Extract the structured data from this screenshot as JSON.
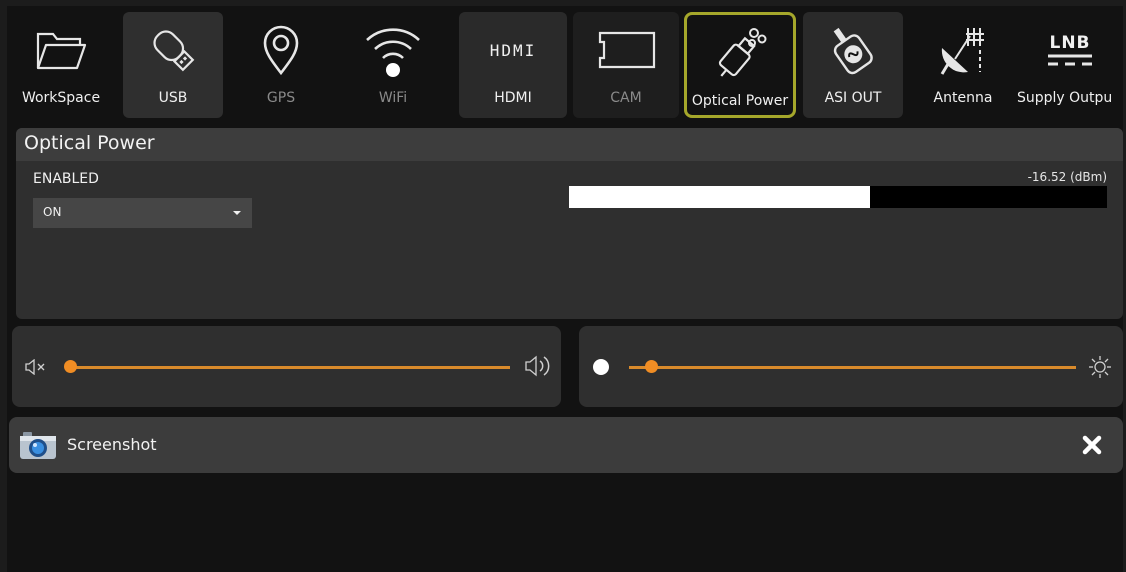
{
  "toolbar": {
    "items": [
      {
        "label": "WorkSpace",
        "icon": "folder-icon",
        "state": "normal"
      },
      {
        "label": "USB",
        "icon": "usb-drive-icon",
        "state": "normal"
      },
      {
        "label": "GPS",
        "icon": "map-pin-icon",
        "state": "disabled"
      },
      {
        "label": "WiFi",
        "icon": "wifi-icon",
        "state": "disabled"
      },
      {
        "label": "HDMI",
        "icon": "hdmi-logo-icon",
        "state": "normal"
      },
      {
        "label": "CAM",
        "icon": "cam-module-icon",
        "state": "disabled"
      },
      {
        "label": "Optical Power",
        "icon": "fiber-connector-icon",
        "state": "selected"
      },
      {
        "label": "ASI OUT",
        "icon": "asi-connector-icon",
        "state": "normal"
      },
      {
        "label": "Antenna",
        "icon": "satellite-dish-icon",
        "state": "normal"
      },
      {
        "label": "Supply Outpu",
        "icon": "lnb-supply-icon",
        "state": "normal"
      }
    ],
    "hdmi_logo_text": "HDMI",
    "lnb_logo_text": "LNB",
    "selected_outline_color": "#a5a72b"
  },
  "optical_power": {
    "title": "Optical Power",
    "enabled_label": "ENABLED",
    "enabled_value": "ON",
    "reading": "-16.52 (dBm)",
    "level_fraction": 0.56
  },
  "volume": {
    "mute_icon": "speaker-mute-icon",
    "max_icon": "speaker-loud-icon",
    "value_fraction": 0.0
  },
  "brightness": {
    "min_icon": "dot-icon",
    "max_icon": "sun-icon",
    "value_fraction": 0.05
  },
  "screenshot": {
    "label": "Screenshot",
    "icon": "camera-icon",
    "close_icon": "close-icon"
  },
  "colors": {
    "accent": "#f08d24",
    "panel": "#2f2f2f",
    "background": "#121212"
  }
}
